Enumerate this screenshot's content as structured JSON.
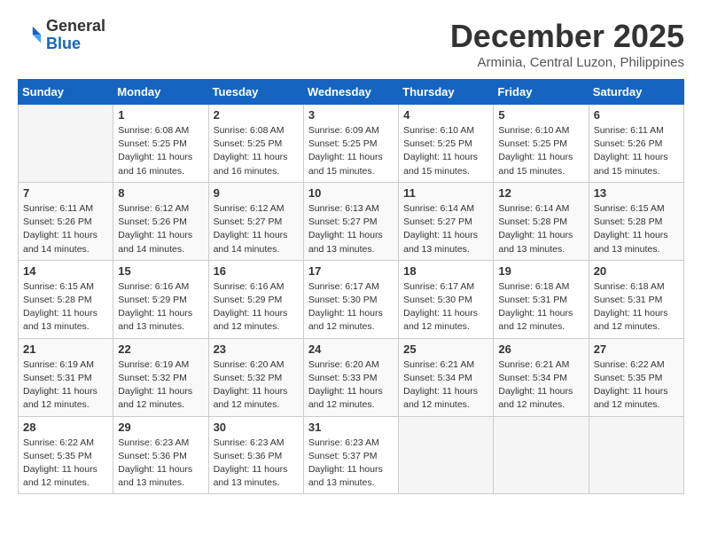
{
  "header": {
    "logo_general": "General",
    "logo_blue": "Blue",
    "month": "December 2025",
    "location": "Arminia, Central Luzon, Philippines"
  },
  "weekdays": [
    "Sunday",
    "Monday",
    "Tuesday",
    "Wednesday",
    "Thursday",
    "Friday",
    "Saturday"
  ],
  "weeks": [
    [
      {
        "day": "",
        "info": ""
      },
      {
        "day": "1",
        "info": "Sunrise: 6:08 AM\nSunset: 5:25 PM\nDaylight: 11 hours\nand 16 minutes."
      },
      {
        "day": "2",
        "info": "Sunrise: 6:08 AM\nSunset: 5:25 PM\nDaylight: 11 hours\nand 16 minutes."
      },
      {
        "day": "3",
        "info": "Sunrise: 6:09 AM\nSunset: 5:25 PM\nDaylight: 11 hours\nand 15 minutes."
      },
      {
        "day": "4",
        "info": "Sunrise: 6:10 AM\nSunset: 5:25 PM\nDaylight: 11 hours\nand 15 minutes."
      },
      {
        "day": "5",
        "info": "Sunrise: 6:10 AM\nSunset: 5:25 PM\nDaylight: 11 hours\nand 15 minutes."
      },
      {
        "day": "6",
        "info": "Sunrise: 6:11 AM\nSunset: 5:26 PM\nDaylight: 11 hours\nand 15 minutes."
      }
    ],
    [
      {
        "day": "7",
        "info": "Sunrise: 6:11 AM\nSunset: 5:26 PM\nDaylight: 11 hours\nand 14 minutes."
      },
      {
        "day": "8",
        "info": "Sunrise: 6:12 AM\nSunset: 5:26 PM\nDaylight: 11 hours\nand 14 minutes."
      },
      {
        "day": "9",
        "info": "Sunrise: 6:12 AM\nSunset: 5:27 PM\nDaylight: 11 hours\nand 14 minutes."
      },
      {
        "day": "10",
        "info": "Sunrise: 6:13 AM\nSunset: 5:27 PM\nDaylight: 11 hours\nand 13 minutes."
      },
      {
        "day": "11",
        "info": "Sunrise: 6:14 AM\nSunset: 5:27 PM\nDaylight: 11 hours\nand 13 minutes."
      },
      {
        "day": "12",
        "info": "Sunrise: 6:14 AM\nSunset: 5:28 PM\nDaylight: 11 hours\nand 13 minutes."
      },
      {
        "day": "13",
        "info": "Sunrise: 6:15 AM\nSunset: 5:28 PM\nDaylight: 11 hours\nand 13 minutes."
      }
    ],
    [
      {
        "day": "14",
        "info": "Sunrise: 6:15 AM\nSunset: 5:28 PM\nDaylight: 11 hours\nand 13 minutes."
      },
      {
        "day": "15",
        "info": "Sunrise: 6:16 AM\nSunset: 5:29 PM\nDaylight: 11 hours\nand 13 minutes."
      },
      {
        "day": "16",
        "info": "Sunrise: 6:16 AM\nSunset: 5:29 PM\nDaylight: 11 hours\nand 12 minutes."
      },
      {
        "day": "17",
        "info": "Sunrise: 6:17 AM\nSunset: 5:30 PM\nDaylight: 11 hours\nand 12 minutes."
      },
      {
        "day": "18",
        "info": "Sunrise: 6:17 AM\nSunset: 5:30 PM\nDaylight: 11 hours\nand 12 minutes."
      },
      {
        "day": "19",
        "info": "Sunrise: 6:18 AM\nSunset: 5:31 PM\nDaylight: 11 hours\nand 12 minutes."
      },
      {
        "day": "20",
        "info": "Sunrise: 6:18 AM\nSunset: 5:31 PM\nDaylight: 11 hours\nand 12 minutes."
      }
    ],
    [
      {
        "day": "21",
        "info": "Sunrise: 6:19 AM\nSunset: 5:31 PM\nDaylight: 11 hours\nand 12 minutes."
      },
      {
        "day": "22",
        "info": "Sunrise: 6:19 AM\nSunset: 5:32 PM\nDaylight: 11 hours\nand 12 minutes."
      },
      {
        "day": "23",
        "info": "Sunrise: 6:20 AM\nSunset: 5:32 PM\nDaylight: 11 hours\nand 12 minutes."
      },
      {
        "day": "24",
        "info": "Sunrise: 6:20 AM\nSunset: 5:33 PM\nDaylight: 11 hours\nand 12 minutes."
      },
      {
        "day": "25",
        "info": "Sunrise: 6:21 AM\nSunset: 5:34 PM\nDaylight: 11 hours\nand 12 minutes."
      },
      {
        "day": "26",
        "info": "Sunrise: 6:21 AM\nSunset: 5:34 PM\nDaylight: 11 hours\nand 12 minutes."
      },
      {
        "day": "27",
        "info": "Sunrise: 6:22 AM\nSunset: 5:35 PM\nDaylight: 11 hours\nand 12 minutes."
      }
    ],
    [
      {
        "day": "28",
        "info": "Sunrise: 6:22 AM\nSunset: 5:35 PM\nDaylight: 11 hours\nand 12 minutes."
      },
      {
        "day": "29",
        "info": "Sunrise: 6:23 AM\nSunset: 5:36 PM\nDaylight: 11 hours\nand 13 minutes."
      },
      {
        "day": "30",
        "info": "Sunrise: 6:23 AM\nSunset: 5:36 PM\nDaylight: 11 hours\nand 13 minutes."
      },
      {
        "day": "31",
        "info": "Sunrise: 6:23 AM\nSunset: 5:37 PM\nDaylight: 11 hours\nand 13 minutes."
      },
      {
        "day": "",
        "info": ""
      },
      {
        "day": "",
        "info": ""
      },
      {
        "day": "",
        "info": ""
      }
    ]
  ]
}
